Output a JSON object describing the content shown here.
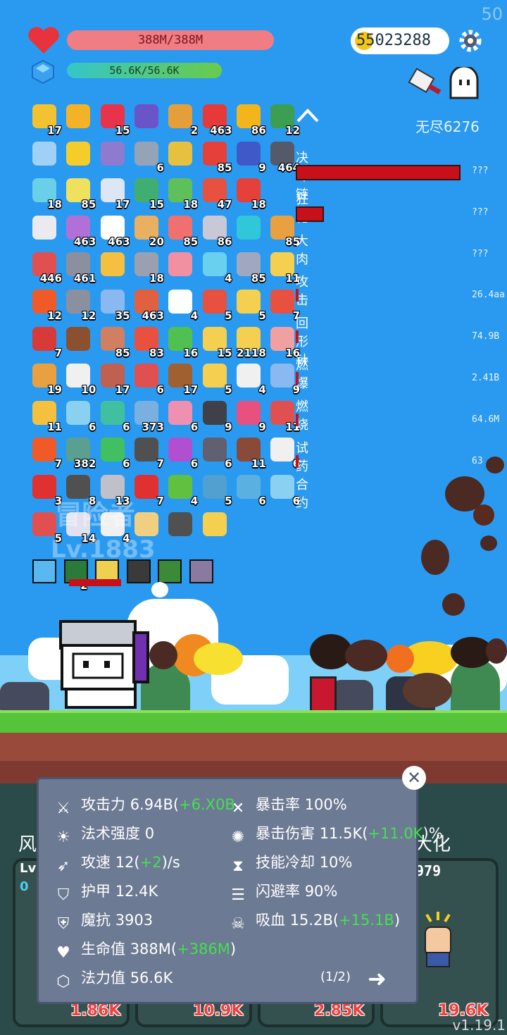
{
  "fps": "50",
  "hp": "388M/388M",
  "mp": "56.6K/56.6K",
  "coins": "55023288",
  "endless": "无尽6276",
  "items": [
    [
      "17",
      "",
      "15",
      "",
      "2",
      "463",
      "86",
      "12"
    ],
    [
      "",
      "",
      "",
      "6",
      "",
      "85",
      "9",
      "464"
    ],
    [
      "18",
      "85",
      "17",
      "15",
      "18",
      "47",
      "18",
      ""
    ],
    [
      "",
      "463",
      "463",
      "20",
      "85",
      "86",
      "",
      "85"
    ],
    [
      "446",
      "461",
      "",
      "18",
      "",
      "4",
      "85",
      "11"
    ],
    [
      "12",
      "12",
      "35",
      "463",
      "4",
      "5",
      "5",
      "7"
    ],
    [
      "7",
      "",
      "85",
      "83",
      "16",
      "15",
      "2118",
      "16"
    ],
    [
      "19",
      "10",
      "17",
      "6",
      "17",
      "5",
      "4",
      "9"
    ],
    [
      "11",
      "6",
      "6",
      "373",
      "6",
      "9",
      "9",
      "11"
    ],
    [
      "7",
      "382",
      "6",
      "7",
      "6",
      "6",
      "11",
      "6"
    ],
    [
      "3",
      "8",
      "13",
      "7",
      "4",
      "5",
      "6",
      "6"
    ],
    [
      "5",
      "14",
      "4",
      "",
      "",
      "",
      ""
    ]
  ],
  "item_colors": [
    [
      "#f2c230",
      "#f4b226",
      "#e8344a",
      "#6a55c8",
      "#e59f3a",
      "#e63a3a",
      "#f3b51c",
      "#3c9e50"
    ],
    [
      "#9fd0f5",
      "#f5cc2a",
      "#8e7bd0",
      "#95a3b8",
      "#e8c040",
      "#e5403a",
      "#3f5ac8",
      "#555a6a"
    ],
    [
      "#6ad0e8",
      "#f0e060",
      "#dce6f5",
      "#3fae70",
      "#5fbf5a",
      "#e85040",
      "#e5403a",
      "#2a9af0"
    ],
    [
      "#eaeaf0",
      "#b070d8",
      "#ffffff",
      "#e8b060",
      "#f07070",
      "#c8c8d8",
      "#30c8d8",
      "#e8a040"
    ],
    [
      "#e05050",
      "#8a90a0",
      "#f5c040",
      "#9aa0b0",
      "#f090a0",
      "#6ad0f0",
      "#a0a8c0",
      "#f5d050"
    ],
    [
      "#f05a28",
      "#8a90a0",
      "#8ab8f0",
      "#e06040",
      "#ffffff",
      "#e85040",
      "#f5d050",
      "#e85040"
    ],
    [
      "#d83a3a",
      "#8a5030",
      "#d08060",
      "#e85040",
      "#50c050",
      "#f5d050",
      "#f5d050",
      "#f0a0a0"
    ],
    [
      "#e8a040",
      "#f0f0f0",
      "#c06050",
      "#e05050",
      "#a06030",
      "#f5d050",
      "#f0f0f0",
      "#8ab8f0"
    ],
    [
      "#f5c040",
      "#8ad0f0",
      "#40c0a0",
      "#7ab0e0",
      "#f090b0",
      "#404048",
      "#e85080",
      "#e05050"
    ],
    [
      "#f05a28",
      "#5aa090",
      "#40c060",
      "#505050",
      "#b050d0",
      "#606070",
      "#8a4a3a",
      "#f0f0f0"
    ],
    [
      "#e03030",
      "#505050",
      "#c0c0c8",
      "#e03030",
      "#60c040",
      "#50a0d0",
      "#5ab0e0",
      "#8ad0f0"
    ],
    [
      "#e05050",
      "#e0e0f0",
      "#f0f0f0",
      "#f0d080",
      "#505050",
      "#f5d050",
      ""
    ]
  ],
  "skills": [
    "",
    "2",
    "",
    "",
    "",
    ""
  ],
  "buffs": [
    {
      "label": "决斗链接",
      "value": "???"
    },
    {
      "label": "狂化",
      "value": "???"
    },
    {
      "label": "大肉",
      "value": "???"
    },
    {
      "label": "攻击",
      "value": "26.4aa"
    },
    {
      "label": "回形针",
      "value": "74.9B"
    },
    {
      "label": "燃爆",
      "value": "2.41B"
    },
    {
      "label": "燃烧",
      "value": "64.6M"
    },
    {
      "label": "试药合约",
      "value": "63"
    }
  ],
  "overlay": {
    "name": "冒险者",
    "level": "Lv.1883"
  },
  "stats": {
    "atk_label": "攻击力",
    "atk": "6.94B(",
    "atk_g": "+6.X0B",
    "spell_label": "法术强度",
    "spell": "0",
    "spd_label": "攻速",
    "spd": "12(",
    "spd_g": "+2",
    "spd_t": ")/s",
    "armor_label": "护甲",
    "armor": "12.4K",
    "mr_label": "魔抗",
    "mr": "3903",
    "hp_label": "生命值",
    "hp": "388M(",
    "hp_g": "+386M",
    "hp_t": ")",
    "mana_label": "法力值",
    "mana": "56.6K",
    "crit_label": "暴击率",
    "crit": "100%",
    "critdmg_label": "暴击伤害",
    "critdmg": "11.5K(",
    "critdmg_g": "+11.0K",
    "critdmg_t": ")%",
    "cd_label": "技能冷却",
    "cd": "10%",
    "dodge_label": "闪避率",
    "dodge": "90%",
    "ls_label": "吸血",
    "ls": "15.2B(",
    "ls_g": "+15.1B",
    "ls_t": ")",
    "page": "(1/2)"
  },
  "behind": {
    "left": "风",
    "lv": "Lv",
    "zero": "0",
    "num": "979",
    "right": "大化"
  },
  "cards": [
    "1.86K",
    "10.9K",
    "2.85K",
    "19.6K"
  ],
  "version": "v1.19.1"
}
